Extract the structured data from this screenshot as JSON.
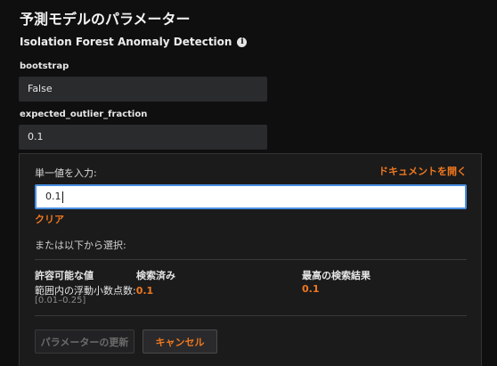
{
  "page": {
    "title": "予測モデルのパラメーター",
    "subtitle": "Isolation Forest Anomaly Detection"
  },
  "params": [
    {
      "label": "bootstrap",
      "value": "False"
    },
    {
      "label": "expected_outlier_fraction",
      "value": "0.1"
    }
  ],
  "editor": {
    "single_value_label": "単一値を入力:",
    "docs_link": "ドキュメントを開く",
    "input_value": "0.1",
    "clear_link": "クリア",
    "or_select_label": "または以下から選択:",
    "columns": {
      "allowed_header": "許容可能な値",
      "searched_header": "検索済み",
      "best_header": "最高の検索結果"
    },
    "allowed_desc": "範囲内の浮動小数点数:",
    "searched_value": "0.1",
    "best_value": "0.1",
    "range": "[0.01–0.25]",
    "update_button": "パラメーターの更新",
    "cancel_button": "キャンセル"
  },
  "colors": {
    "accent": "#f0781e",
    "background": "#0f0f10",
    "panel": "#1b1b1c",
    "input_focus": "#4a90e2"
  }
}
